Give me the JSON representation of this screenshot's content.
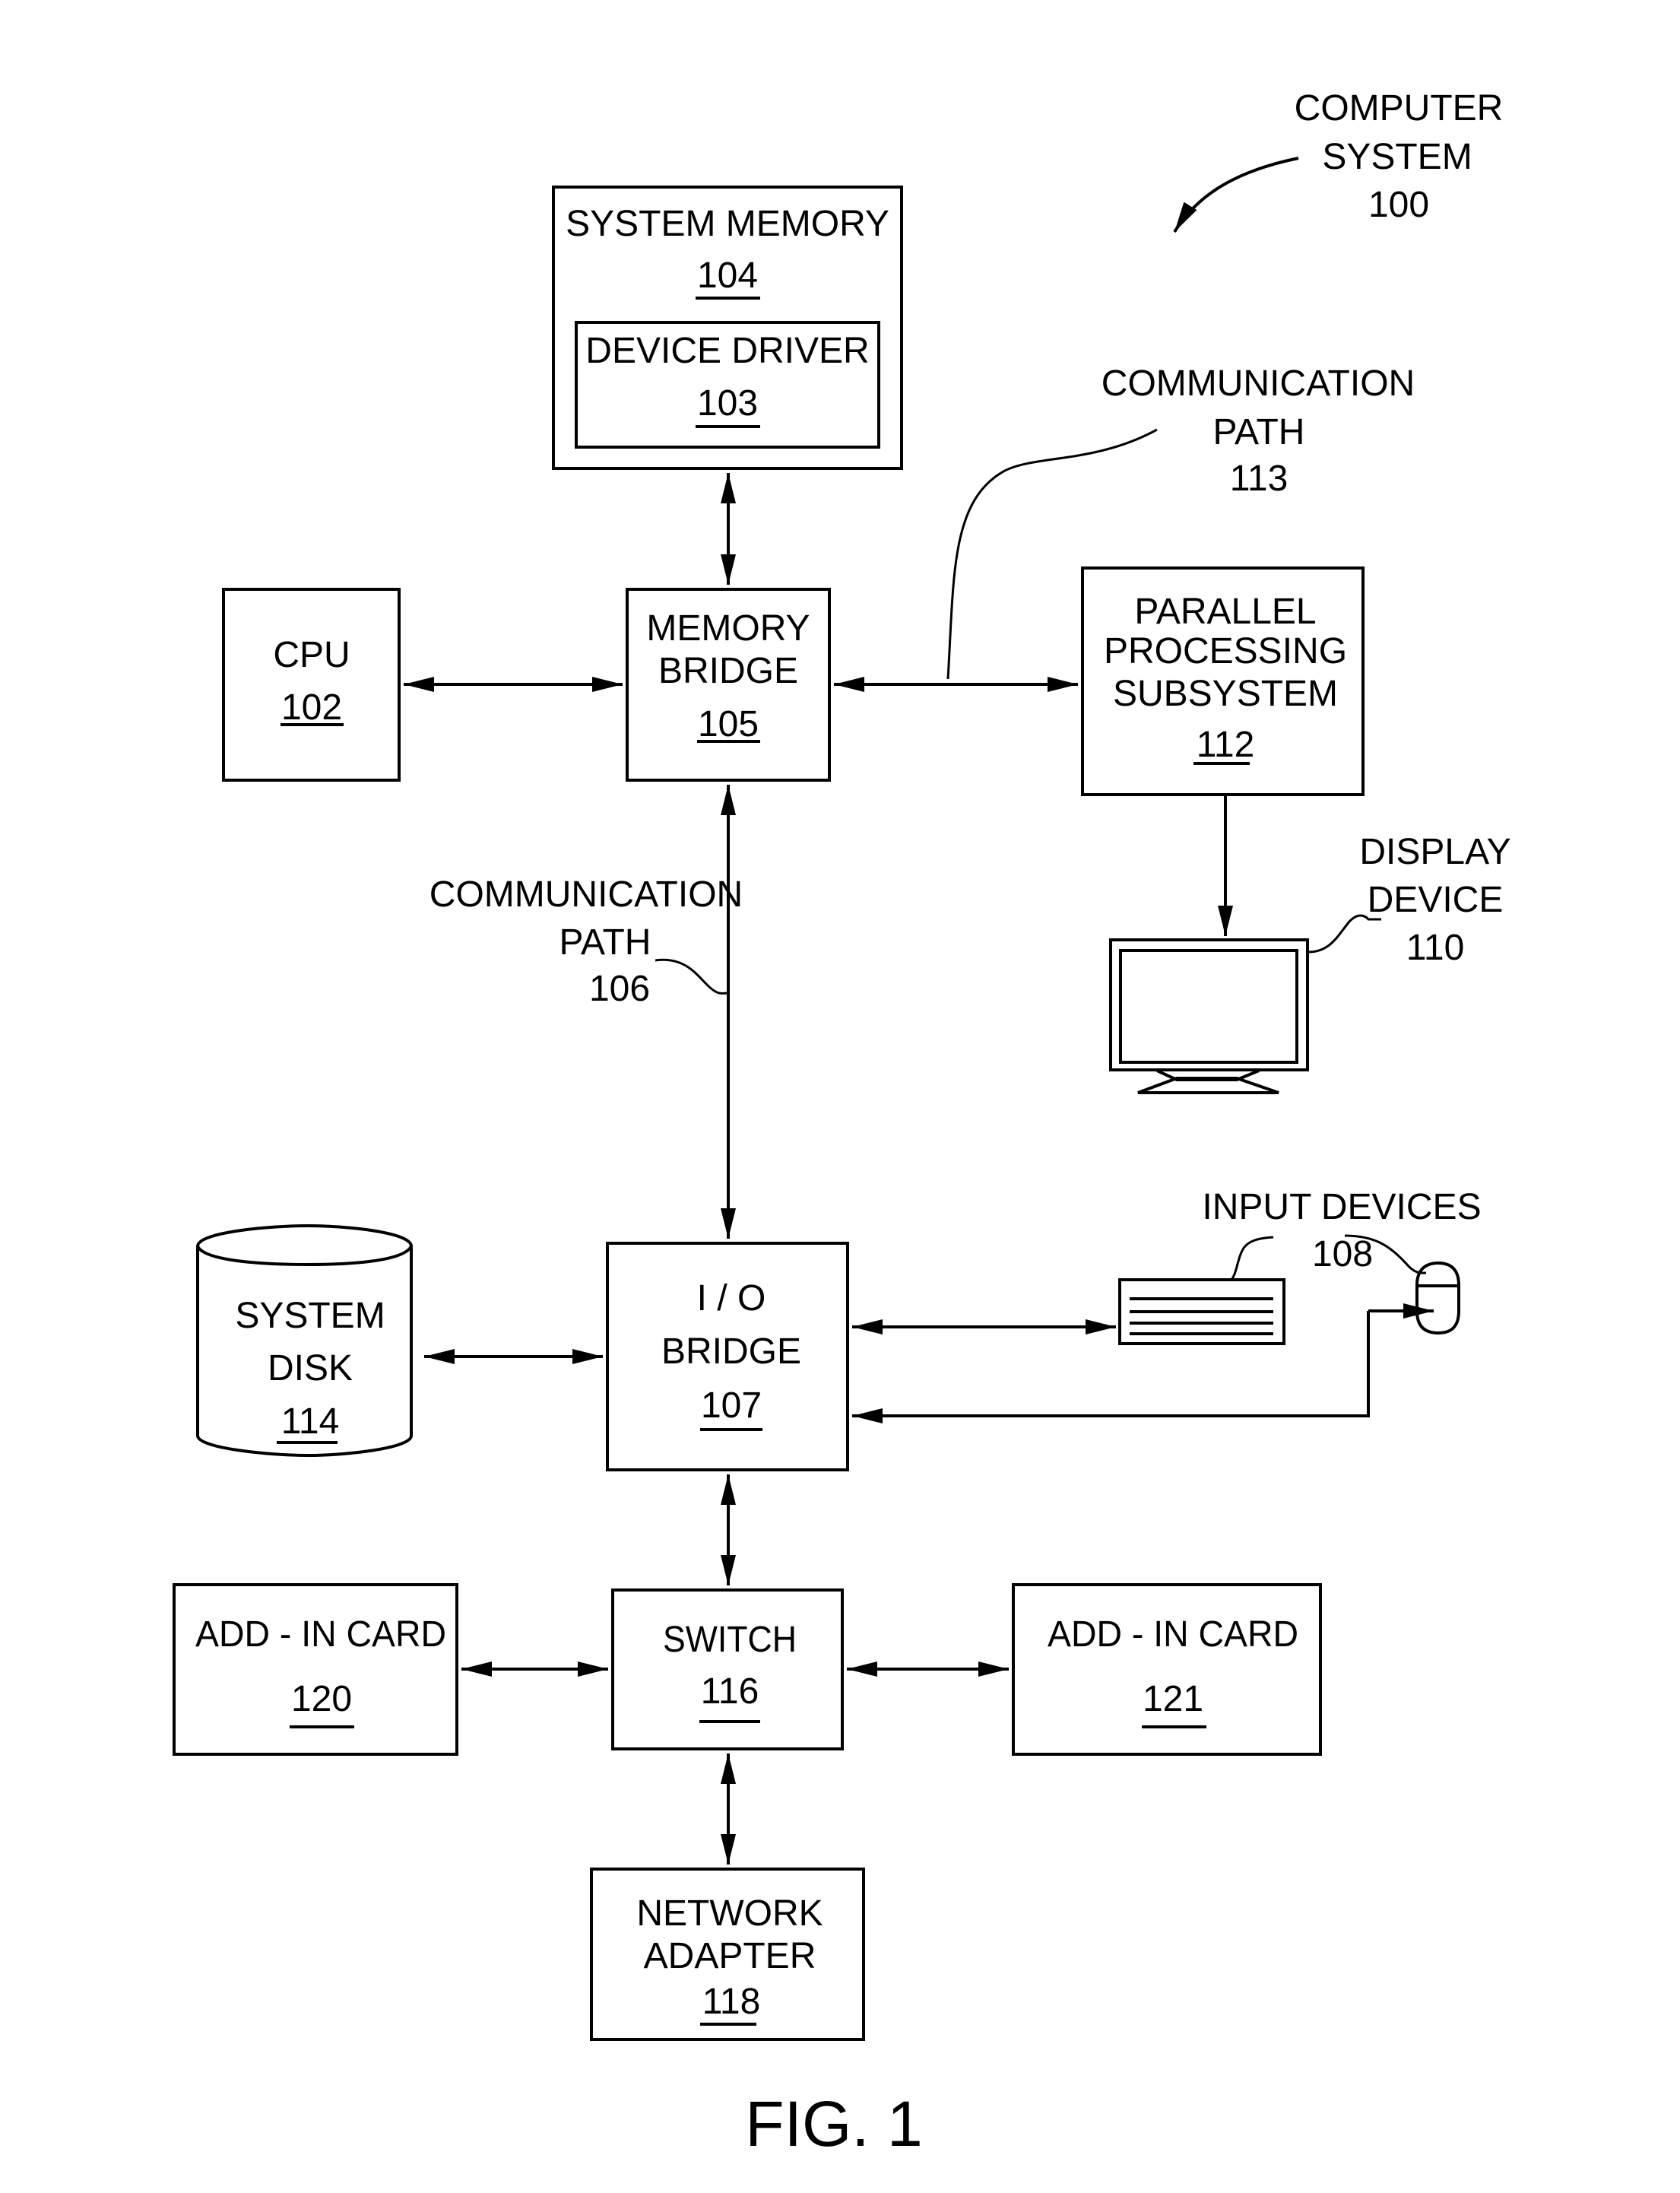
{
  "figure": {
    "caption": "FIG. 1",
    "system": {
      "line1": "COMPUTER",
      "line2": "SYSTEM",
      "ref": "100"
    }
  },
  "components": {
    "system_memory": {
      "lines": [
        "SYSTEM MEMORY"
      ],
      "ref": "104"
    },
    "device_driver": {
      "lines": [
        "DEVICE DRIVER"
      ],
      "ref": "103"
    },
    "cpu": {
      "lines": [
        "CPU"
      ],
      "ref": "102"
    },
    "memory_bridge": {
      "lines": [
        "MEMORY",
        "BRIDGE"
      ],
      "ref": "105"
    },
    "parallel_processing": {
      "lines": [
        "PARALLEL",
        "PROCESSING",
        "SUBSYSTEM"
      ],
      "ref": "112"
    },
    "display_device": {
      "lines": [
        "DISPLAY",
        "DEVICE"
      ],
      "ref": "110"
    },
    "io_bridge": {
      "lines": [
        "I / O",
        "BRIDGE"
      ],
      "ref": "107"
    },
    "system_disk": {
      "lines": [
        "SYSTEM",
        "DISK"
      ],
      "ref": "114"
    },
    "input_devices": {
      "lines": [
        "INPUT  DEVICES"
      ],
      "ref": "108"
    },
    "switch": {
      "lines": [
        "SWITCH"
      ],
      "ref": "116"
    },
    "add_in_card_left": {
      "lines": [
        "ADD - IN CARD"
      ],
      "ref": "120"
    },
    "add_in_card_right": {
      "lines": [
        "ADD - IN CARD"
      ],
      "ref": "121"
    },
    "network_adapter": {
      "lines": [
        "NETWORK",
        "ADAPTER"
      ],
      "ref": "118"
    }
  },
  "paths": {
    "comm_path_113": {
      "line1": "COMMUNICATION",
      "line2": "PATH",
      "ref": "113"
    },
    "comm_path_106": {
      "line1": "COMMUNICATION",
      "line2": "PATH",
      "ref": "106"
    }
  }
}
